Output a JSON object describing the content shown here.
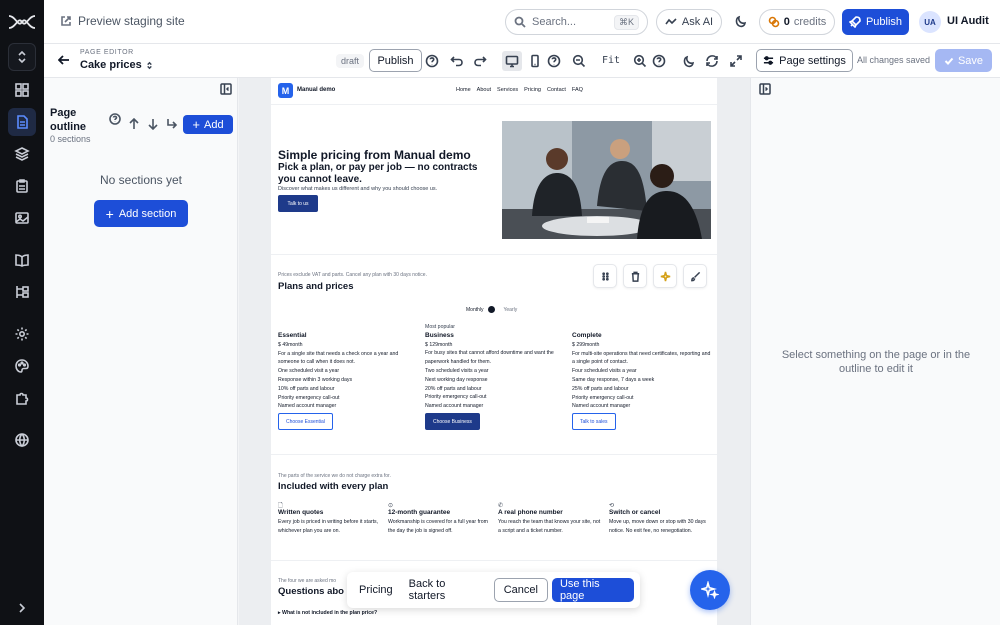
{
  "topbar": {
    "preview_label": "Preview staging site",
    "search_placeholder": "Search...",
    "search_shortcut": "⌘K",
    "ask_ai": "Ask AI",
    "credits_count": "0",
    "credits_label": "credits",
    "publish": "Publish",
    "user_initials": "UA",
    "user_name": "UI Audit"
  },
  "editor": {
    "eyebrow": "PAGE EDITOR",
    "page_name": "Cake prices",
    "status": "draft",
    "publish": "Publish",
    "zoom": "Fit",
    "page_settings": "Page settings",
    "save_status": "All changes saved",
    "save": "Save"
  },
  "outline": {
    "title": "Page outline",
    "count": "0 sections",
    "add": "Add",
    "empty": "No sections yet",
    "add_section": "Add section"
  },
  "site": {
    "logo_letter": "M",
    "name": "Manual demo",
    "nav": [
      "Home",
      "About",
      "Services",
      "Pricing",
      "Contact",
      "FAQ"
    ],
    "hero": {
      "title": "Simple pricing from Manual demo",
      "subtitle": "Pick a plan, or pay per job — no contracts you cannot leave.",
      "description": "Discover what makes us different and why you should choose us.",
      "cta": "Talk to us"
    },
    "pricing": {
      "note": "Prices exclude VAT and parts. Cancel any plan with 30 days notice.",
      "title": "Plans and prices",
      "toggle_monthly": "Monthly",
      "toggle_yearly": "Yearly",
      "plans": [
        {
          "tag": "",
          "name": "Essential",
          "price": "$  49month",
          "desc": "For a single site that needs a check once a year and someone to call when it does not.",
          "features": [
            "One scheduled visit a year",
            "Response within 3 working days",
            "10% off parts and labour",
            "Priority emergency call-out",
            "Named account manager"
          ],
          "button": "Choose Essential"
        },
        {
          "tag": "Most popular",
          "name": "Business",
          "price": "$  129month",
          "desc": "For busy sites that cannot afford downtime and want the paperwork handled for them.",
          "features": [
            "Two scheduled visits a year",
            "Next working day response",
            "20% off parts and labour",
            "Priority emergency call-out",
            "Named account manager"
          ],
          "button": "Choose Business"
        },
        {
          "tag": "",
          "name": "Complete",
          "price": "$  299month",
          "desc": "For multi-site operations that need certificates, reporting and a single point of contact.",
          "features": [
            "Four scheduled visits a year",
            "Same day response, 7 days a week",
            "25% off parts and labour",
            "Priority emergency call-out",
            "Named account manager"
          ],
          "button": "Talk to sales"
        }
      ]
    },
    "included": {
      "note": "The parts of the service we do not charge extra for.",
      "title": "Included with every plan",
      "items": [
        {
          "icon": "🗋",
          "name": "Written quotes",
          "desc": "Every job is priced in writing before it starts, whichever plan you are on."
        },
        {
          "icon": "⊙",
          "name": "12-month guarantee",
          "desc": "Workmanship is covered for a full year from the day the job is signed off."
        },
        {
          "icon": "✆",
          "name": "A real phone number",
          "desc": "You reach the team that knows your site, not a script and a ticket number."
        },
        {
          "icon": "⟲",
          "name": "Switch or cancel",
          "desc": "Move up, move down or stop with 30 days notice. No exit fee, no renegotiation."
        }
      ]
    },
    "faq": {
      "note": "The four we are asked mo",
      "title": "Questions abo",
      "first_question": "▸ What is not included in the plan price?"
    }
  },
  "bottombar": {
    "link1": "Pricing",
    "link2": "Back to starters",
    "cancel": "Cancel",
    "use": "Use this page"
  },
  "inspector": {
    "message": "Select something on the page or in the outline to edit it"
  },
  "colors": {
    "accent": "#1d4ed8",
    "rail": "#0f1115",
    "site_primary": "#1e3a8a"
  }
}
